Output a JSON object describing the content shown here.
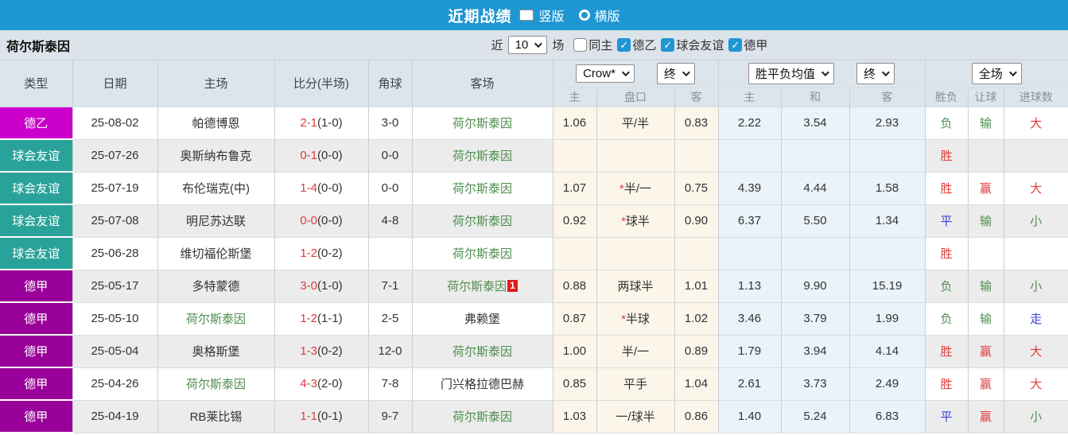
{
  "topbar": {
    "title": "近期战绩",
    "options": [
      {
        "label": "竖版",
        "selected": true
      },
      {
        "label": "横版",
        "selected": false
      }
    ]
  },
  "filterbar": {
    "team": "荷尔斯泰因",
    "recent_label": "近",
    "recent_value": "10",
    "matches_label": "场",
    "same_home": {
      "label": "同主",
      "checked": false
    },
    "leagues": [
      {
        "label": "德乙",
        "checked": true
      },
      {
        "label": "球会友谊",
        "checked": true
      },
      {
        "label": "德甲",
        "checked": true
      }
    ]
  },
  "table": {
    "headers": {
      "type": "类型",
      "date": "日期",
      "home": "主场",
      "score": "比分(半场)",
      "corner": "角球",
      "away": "客场"
    },
    "selects": {
      "odds_company": "Crow*",
      "odds_final": "终",
      "avg": "胜平负均值",
      "avg_final": "终",
      "full": "全场"
    },
    "subheaders": {
      "odds_home": "主",
      "odds_handicap": "盘口",
      "odds_away": "客",
      "avg_home": "主",
      "avg_draw": "和",
      "avg_away": "客",
      "result": "胜负",
      "handicap_result": "让球",
      "goals": "进球数"
    },
    "rows": [
      {
        "league": {
          "label": "德乙",
          "type": "de2"
        },
        "date": "25-08-02",
        "home": {
          "name": "帕德博恩",
          "target": false
        },
        "score": {
          "ft": "2-1",
          "ht": "(1-0)"
        },
        "corner": "3-0",
        "away": {
          "name": "荷尔斯泰因",
          "target": true,
          "badge": ""
        },
        "odds": {
          "home": "1.06",
          "star": false,
          "handicap": "平/半",
          "away": "0.83"
        },
        "avg": {
          "home": "2.22",
          "draw": "3.54",
          "away": "2.93"
        },
        "verdict": {
          "result": {
            "t": "负",
            "c": "g"
          },
          "handicap": {
            "t": "输",
            "c": "g"
          },
          "goals": {
            "t": "大",
            "c": "r"
          }
        }
      },
      {
        "league": {
          "label": "球会友谊",
          "type": "friendly"
        },
        "date": "25-07-26",
        "home": {
          "name": "奥斯纳布鲁克",
          "target": false
        },
        "score": {
          "ft": "0-1",
          "ht": "(0-0)"
        },
        "corner": "0-0",
        "away": {
          "name": "荷尔斯泰因",
          "target": true,
          "badge": ""
        },
        "odds": {
          "home": "",
          "star": false,
          "handicap": "",
          "away": ""
        },
        "avg": {
          "home": "",
          "draw": "",
          "away": ""
        },
        "verdict": {
          "result": {
            "t": "胜",
            "c": "r"
          },
          "handicap": {
            "t": "",
            "c": ""
          },
          "goals": {
            "t": "",
            "c": ""
          }
        }
      },
      {
        "league": {
          "label": "球会友谊",
          "type": "friendly"
        },
        "date": "25-07-19",
        "home": {
          "name": "布伦瑞克(中)",
          "target": false
        },
        "score": {
          "ft": "1-4",
          "ht": "(0-0)"
        },
        "corner": "0-0",
        "away": {
          "name": "荷尔斯泰因",
          "target": true,
          "badge": ""
        },
        "odds": {
          "home": "1.07",
          "star": true,
          "handicap": "半/一",
          "away": "0.75"
        },
        "avg": {
          "home": "4.39",
          "draw": "4.44",
          "away": "1.58"
        },
        "verdict": {
          "result": {
            "t": "胜",
            "c": "r"
          },
          "handicap": {
            "t": "赢",
            "c": "r"
          },
          "goals": {
            "t": "大",
            "c": "r"
          }
        }
      },
      {
        "league": {
          "label": "球会友谊",
          "type": "friendly"
        },
        "date": "25-07-08",
        "home": {
          "name": "明尼苏达联",
          "target": false
        },
        "score": {
          "ft": "0-0",
          "ht": "(0-0)"
        },
        "corner": "4-8",
        "away": {
          "name": "荷尔斯泰因",
          "target": true,
          "badge": ""
        },
        "odds": {
          "home": "0.92",
          "star": true,
          "handicap": "球半",
          "away": "0.90"
        },
        "avg": {
          "home": "6.37",
          "draw": "5.50",
          "away": "1.34"
        },
        "verdict": {
          "result": {
            "t": "平",
            "c": "b"
          },
          "handicap": {
            "t": "输",
            "c": "g"
          },
          "goals": {
            "t": "小",
            "c": "g"
          }
        }
      },
      {
        "league": {
          "label": "球会友谊",
          "type": "friendly"
        },
        "date": "25-06-28",
        "home": {
          "name": "维切福伦斯堡",
          "target": false
        },
        "score": {
          "ft": "1-2",
          "ht": "(0-2)"
        },
        "corner": "",
        "away": {
          "name": "荷尔斯泰因",
          "target": true,
          "badge": ""
        },
        "odds": {
          "home": "",
          "star": false,
          "handicap": "",
          "away": ""
        },
        "avg": {
          "home": "",
          "draw": "",
          "away": ""
        },
        "verdict": {
          "result": {
            "t": "胜",
            "c": "r"
          },
          "handicap": {
            "t": "",
            "c": ""
          },
          "goals": {
            "t": "",
            "c": ""
          }
        }
      },
      {
        "league": {
          "label": "德甲",
          "type": "de1"
        },
        "date": "25-05-17",
        "home": {
          "name": "多特蒙德",
          "target": false
        },
        "score": {
          "ft": "3-0",
          "ht": "(1-0)"
        },
        "corner": "7-1",
        "away": {
          "name": "荷尔斯泰因",
          "target": true,
          "badge": "1"
        },
        "odds": {
          "home": "0.88",
          "star": false,
          "handicap": "两球半",
          "away": "1.01"
        },
        "avg": {
          "home": "1.13",
          "draw": "9.90",
          "away": "15.19"
        },
        "verdict": {
          "result": {
            "t": "负",
            "c": "g"
          },
          "handicap": {
            "t": "输",
            "c": "g"
          },
          "goals": {
            "t": "小",
            "c": "g"
          }
        }
      },
      {
        "league": {
          "label": "德甲",
          "type": "de1"
        },
        "date": "25-05-10",
        "home": {
          "name": "荷尔斯泰因",
          "target": true
        },
        "score": {
          "ft": "1-2",
          "ht": "(1-1)"
        },
        "corner": "2-5",
        "away": {
          "name": "弗赖堡",
          "target": false,
          "badge": ""
        },
        "odds": {
          "home": "0.87",
          "star": true,
          "handicap": "半球",
          "away": "1.02"
        },
        "avg": {
          "home": "3.46",
          "draw": "3.79",
          "away": "1.99"
        },
        "verdict": {
          "result": {
            "t": "负",
            "c": "g"
          },
          "handicap": {
            "t": "输",
            "c": "g"
          },
          "goals": {
            "t": "走",
            "c": "b"
          }
        }
      },
      {
        "league": {
          "label": "德甲",
          "type": "de1"
        },
        "date": "25-05-04",
        "home": {
          "name": "奥格斯堡",
          "target": false
        },
        "score": {
          "ft": "1-3",
          "ht": "(0-2)"
        },
        "corner": "12-0",
        "away": {
          "name": "荷尔斯泰因",
          "target": true,
          "badge": ""
        },
        "odds": {
          "home": "1.00",
          "star": false,
          "handicap": "半/一",
          "away": "0.89"
        },
        "avg": {
          "home": "1.79",
          "draw": "3.94",
          "away": "4.14"
        },
        "verdict": {
          "result": {
            "t": "胜",
            "c": "r"
          },
          "handicap": {
            "t": "赢",
            "c": "r"
          },
          "goals": {
            "t": "大",
            "c": "r"
          }
        }
      },
      {
        "league": {
          "label": "德甲",
          "type": "de1"
        },
        "date": "25-04-26",
        "home": {
          "name": "荷尔斯泰因",
          "target": true
        },
        "score": {
          "ft": "4-3",
          "ht": "(2-0)"
        },
        "corner": "7-8",
        "away": {
          "name": "门兴格拉德巴赫",
          "target": false,
          "badge": ""
        },
        "odds": {
          "home": "0.85",
          "star": false,
          "handicap": "平手",
          "away": "1.04"
        },
        "avg": {
          "home": "2.61",
          "draw": "3.73",
          "away": "2.49"
        },
        "verdict": {
          "result": {
            "t": "胜",
            "c": "r"
          },
          "handicap": {
            "t": "赢",
            "c": "r"
          },
          "goals": {
            "t": "大",
            "c": "r"
          }
        }
      },
      {
        "league": {
          "label": "德甲",
          "type": "de1"
        },
        "date": "25-04-19",
        "home": {
          "name": "RB莱比锡",
          "target": false
        },
        "score": {
          "ft": "1-1",
          "ht": "(0-1)"
        },
        "corner": "9-7",
        "away": {
          "name": "荷尔斯泰因",
          "target": true,
          "badge": ""
        },
        "odds": {
          "home": "1.03",
          "star": false,
          "handicap": "一/球半",
          "away": "0.86"
        },
        "avg": {
          "home": "1.40",
          "draw": "5.24",
          "away": "6.83"
        },
        "verdict": {
          "result": {
            "t": "平",
            "c": "b"
          },
          "handicap": {
            "t": "赢",
            "c": "r"
          },
          "goals": {
            "t": "小",
            "c": "g"
          }
        }
      }
    ]
  },
  "colors": {
    "topbar_blue": "#1e96d2",
    "league_de2": "#cc00cc",
    "league_friendly": "#29a39a",
    "league_de1": "#990099",
    "target_team_green": "#4e8d4e",
    "score_red": "#e03b3b",
    "draw_blue": "#3c3cdc"
  }
}
